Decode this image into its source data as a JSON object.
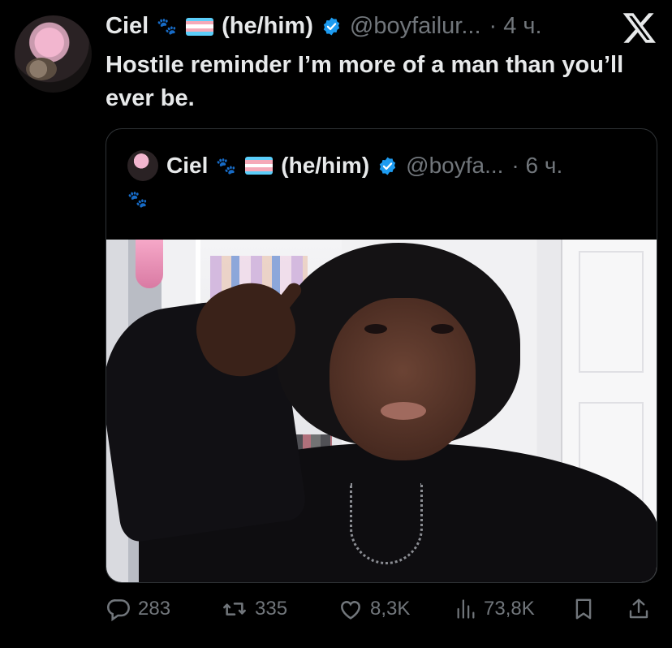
{
  "tweet": {
    "author_name": "Ciel",
    "pronouns": "(he/him)",
    "handle": "@boyfailur...",
    "time": "· 4 ч.",
    "text": "Hostile reminder I’m more of a man than you’ll ever be."
  },
  "quoted": {
    "author_name": "Ciel",
    "pronouns": "(he/him)",
    "handle": "@boyfa...",
    "time": "· 6 ч."
  },
  "actions": {
    "replies": "283",
    "retweets": "335",
    "likes": "8,3K",
    "views": "73,8K"
  },
  "colors": {
    "background": "#000000",
    "text": "#e7e9ea",
    "muted": "#71767b",
    "verified": "#1d9bf0",
    "border": "#2f3336"
  },
  "icons": [
    "paw-icon",
    "trans-flag-icon",
    "verified-icon",
    "x-logo-icon",
    "reply-icon",
    "retweet-icon",
    "like-icon",
    "views-icon",
    "bookmark-icon",
    "share-icon"
  ]
}
